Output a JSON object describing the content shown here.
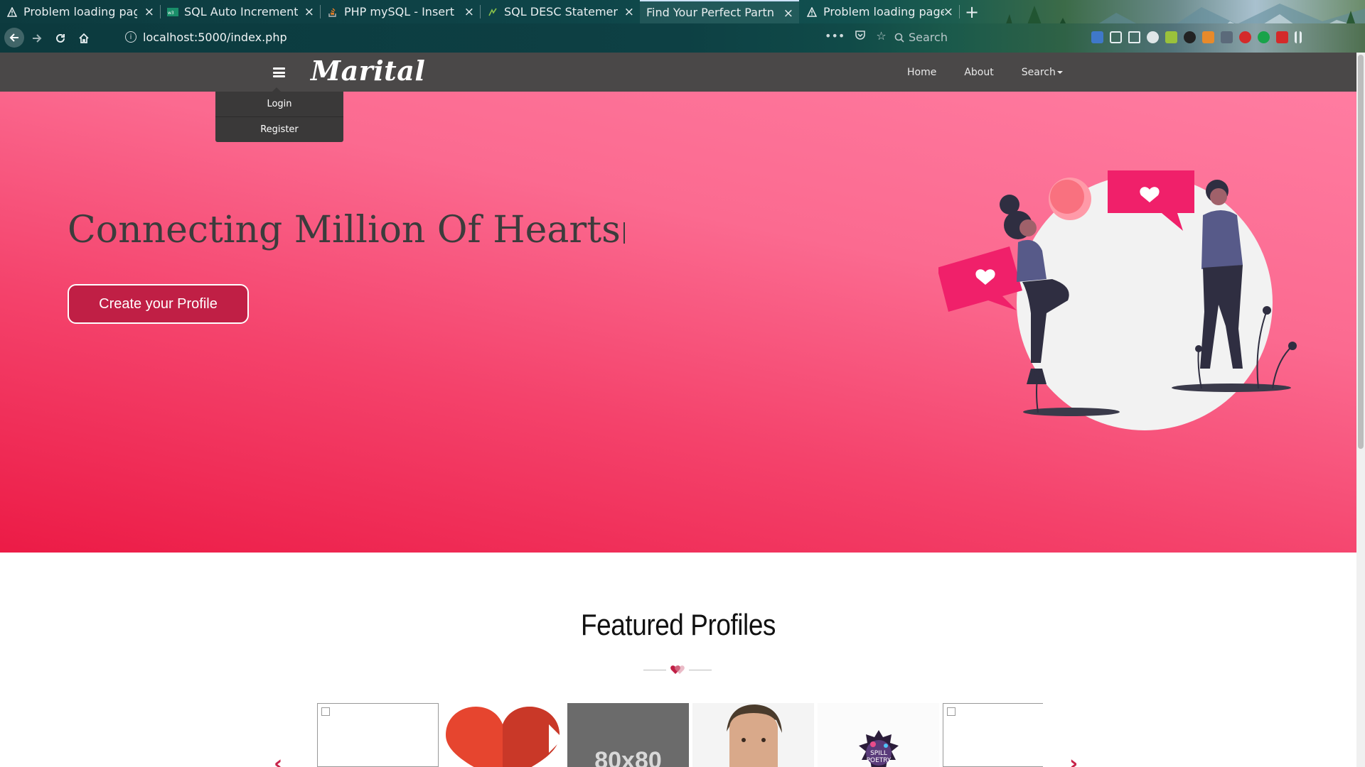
{
  "browser": {
    "tabs": [
      {
        "title": "Problem loading page",
        "icon": "warning-icon"
      },
      {
        "title": "SQL Auto Increment",
        "icon": "w3schools-favicon"
      },
      {
        "title": "PHP mySQL - Insert ne",
        "icon": "stackoverflow-favicon"
      },
      {
        "title": "SQL DESC Statement -",
        "icon": "sql-favicon"
      },
      {
        "title": "Find Your Perfect Partner",
        "icon": "",
        "active": true
      },
      {
        "title": "Problem loading page",
        "icon": "warning-icon"
      }
    ],
    "url": "localhost:5000/index.php",
    "search_placeholder": "Search"
  },
  "site": {
    "brand": "Marital",
    "menu": {
      "login": "Login",
      "register": "Register"
    },
    "nav": {
      "home": "Home",
      "about": "About",
      "search": "Search"
    }
  },
  "hero": {
    "title": "Connecting Million Of Hearts",
    "cta": "Create your Profile"
  },
  "featured": {
    "title": "Featured Profiles",
    "thumb_80x80_text": "80x80",
    "spill_badge_text": "SPILL POETRY"
  },
  "colors": {
    "accent": "#c01f45",
    "hero_top": "#ff7ca1",
    "hero_bottom": "#ec1b46",
    "site_nav": "#4a4848"
  }
}
